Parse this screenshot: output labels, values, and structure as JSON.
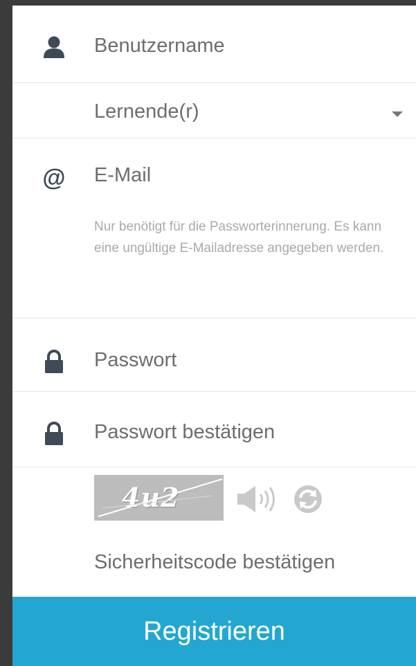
{
  "form": {
    "username": {
      "placeholder": "Benutzername",
      "icon": "user-icon"
    },
    "role": {
      "selected": "Lernende(r)",
      "icon": "caret-down-icon"
    },
    "email": {
      "placeholder": "E-Mail",
      "icon": "at-icon",
      "at_symbol": "@",
      "note": "Nur benötigt für die Passworterinnerung. Es kann eine ungültige E-Mailadresse angegeben werden."
    },
    "password": {
      "placeholder": "Passwort",
      "icon": "lock-icon"
    },
    "password_confirm": {
      "placeholder": "Passwort bestätigen",
      "icon": "lock-icon"
    },
    "captcha": {
      "code": "4u2",
      "audio_icon": "speaker-icon",
      "refresh_icon": "refresh-icon",
      "confirm_placeholder": "Sicherheitscode bestätigen"
    },
    "submit_label": "Registrieren"
  },
  "colors": {
    "button_bg": "#23a7d2",
    "icon_dark": "#3f4a57",
    "text_gray": "#6d6d6d",
    "note_gray": "#a9a9a9",
    "divider": "#e2e7ef"
  }
}
